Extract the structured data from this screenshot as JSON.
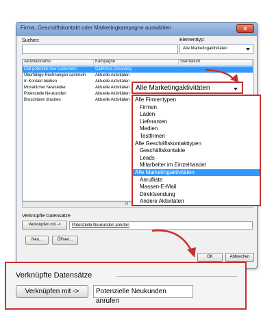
{
  "dialog": {
    "title": "Firma, Geschäftskontakt oder Marketingkampagne auswählen",
    "close_label": "x",
    "search_label": "Suchen:",
    "search_value": "",
    "type_label": "Elementtyp:",
    "type_selected": "Alle Marketingaktivitäten",
    "columns": [
      "Aktivitätsname",
      "Kampagne",
      "Startdatum"
    ],
    "rows": [
      {
        "name": "Call potential new customers",
        "campaign": "California Dreaming",
        "selected": true
      },
      {
        "name": "Überfällige Rechnungen sammeln",
        "campaign": "Aktuelle Aktivitäten",
        "selected": false
      },
      {
        "name": "In Kontakt bleiben",
        "campaign": "Aktuelle Aktivitäten",
        "selected": false
      },
      {
        "name": "Monatlicher Newsletter",
        "campaign": "Aktuelle Aktivitäten",
        "selected": false
      },
      {
        "name": "Potenzielle Neukunden",
        "campaign": "Aktuelle Aktivitäten",
        "selected": false
      },
      {
        "name": "Broschüren drucken",
        "campaign": "Aktuelle Aktivitäten",
        "selected": false
      }
    ],
    "scroll_thumb_label": "III",
    "linked_label": "Verknüpfte Datensätze",
    "link_button": "Verknüpfen mit ->",
    "linked_value": "Potenzielle Neukunden anrufen",
    "new_button": "Neu...",
    "open_button": "Öffnen...",
    "ok_button": "OK",
    "cancel_button": "Abbrechen"
  },
  "zoom_dropdown": {
    "selected": "Alle Marketingaktivitäten",
    "options": [
      {
        "label": "Alle Firmentypen",
        "indent": false,
        "selected": false
      },
      {
        "label": "Firmen",
        "indent": true,
        "selected": false
      },
      {
        "label": "Läden",
        "indent": true,
        "selected": false
      },
      {
        "label": "Lieferanten",
        "indent": true,
        "selected": false
      },
      {
        "label": "Medien",
        "indent": true,
        "selected": false
      },
      {
        "label": "Testfirmen",
        "indent": true,
        "selected": false
      },
      {
        "label": "Alle Geschäftskontakttypen",
        "indent": false,
        "selected": false
      },
      {
        "label": "Geschäftskontakte",
        "indent": true,
        "selected": false
      },
      {
        "label": "Leads",
        "indent": true,
        "selected": false
      },
      {
        "label": "Mitarbeiter im Einzelhandel",
        "indent": true,
        "selected": false
      },
      {
        "label": "Alle Marketingaktivitäten",
        "indent": false,
        "selected": true
      },
      {
        "label": "Anrufliste",
        "indent": true,
        "selected": false
      },
      {
        "label": "Massen-E-Mail",
        "indent": true,
        "selected": false
      },
      {
        "label": "Direktsendung",
        "indent": true,
        "selected": false
      },
      {
        "label": "Andere Aktivitäten",
        "indent": true,
        "selected": false
      }
    ]
  },
  "zoom_panel": {
    "label": "Verknüpfte Datensätze",
    "link_button": "Verknüpfen mit ->",
    "linked_value": "Potenzielle Neukunden anrufen"
  },
  "colors": {
    "highlight": "#3399ff",
    "callout_red": "#c62f2f"
  }
}
